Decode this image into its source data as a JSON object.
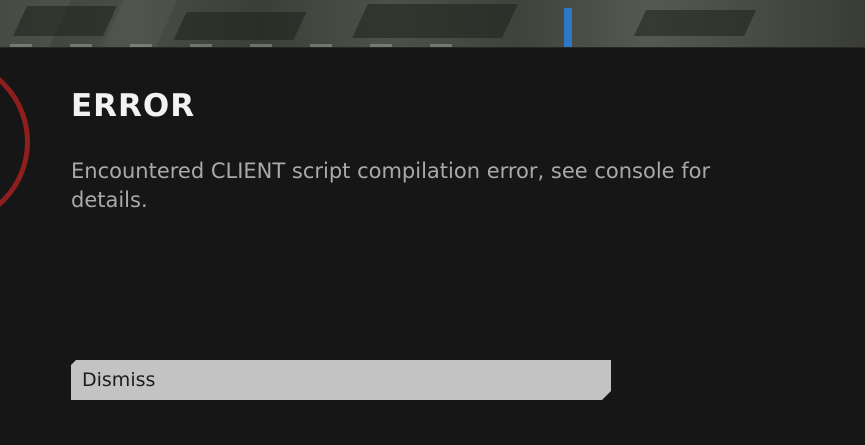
{
  "dialog": {
    "title": "ERROR",
    "message": "Encountered CLIENT script compilation error, see console for details.",
    "dismiss_label": "Dismiss"
  },
  "colors": {
    "panel_background": "#161616",
    "ring_accent": "#8f1e1e",
    "button_background": "#c3c3c3",
    "marker_blue": "#2c78c4"
  },
  "icons": {
    "ring": "red-ring-icon"
  }
}
